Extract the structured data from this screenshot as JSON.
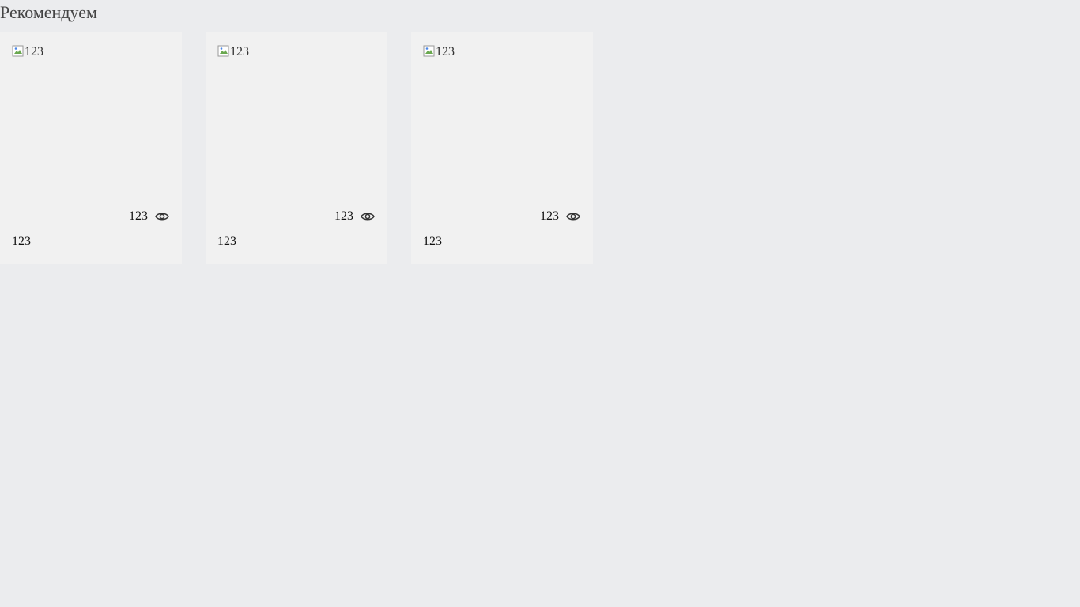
{
  "section": {
    "title": "Рекомендуем"
  },
  "cards": [
    {
      "image_alt": "123",
      "views": "123",
      "title": "123"
    },
    {
      "image_alt": "123",
      "views": "123",
      "title": "123"
    },
    {
      "image_alt": "123",
      "views": "123",
      "title": "123"
    }
  ],
  "icons": {
    "views": "eye-icon",
    "image": "broken-image-icon"
  }
}
